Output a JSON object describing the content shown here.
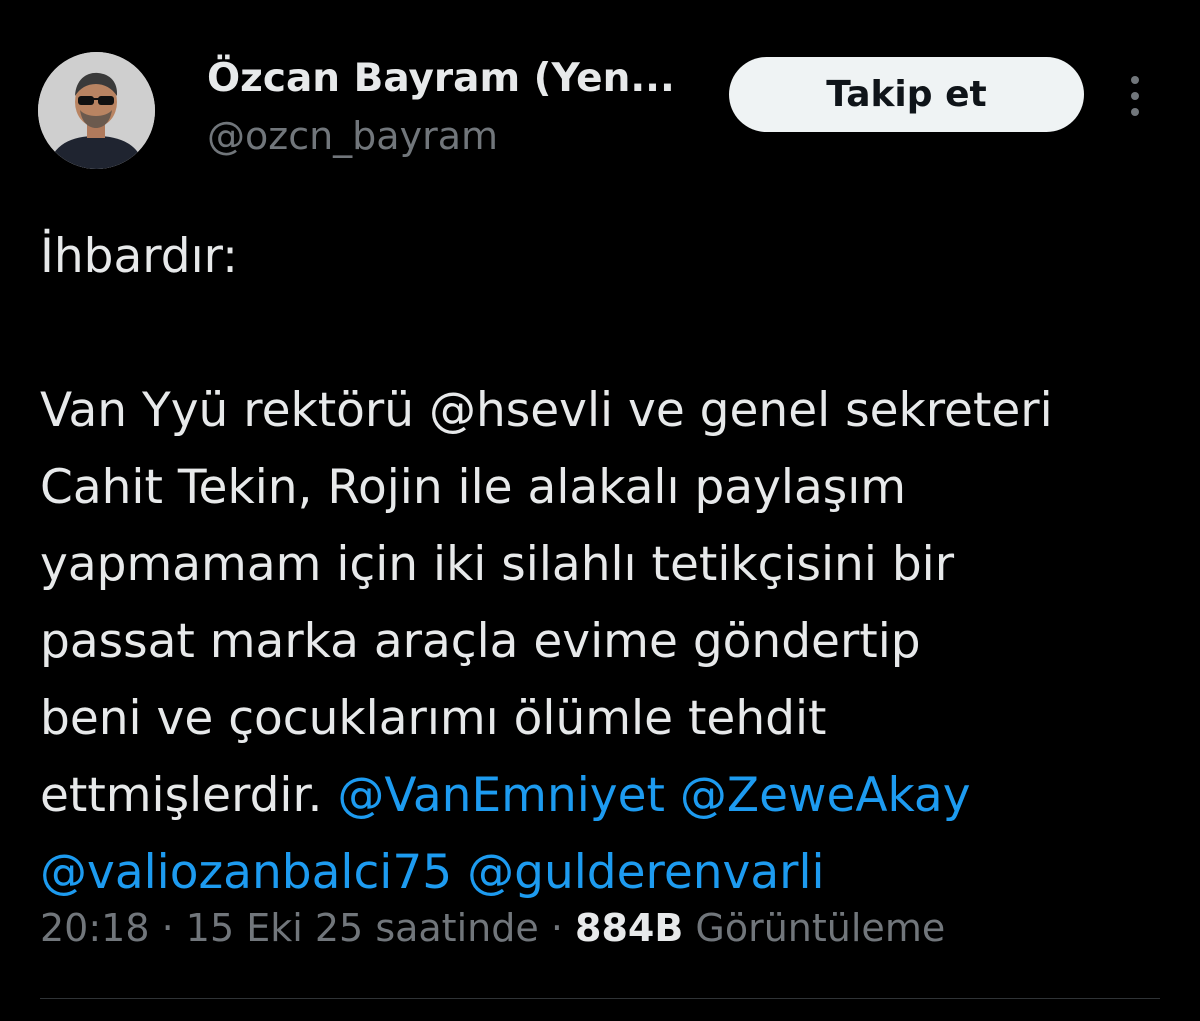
{
  "author": {
    "display_name": "Özcan Bayram (Yen...",
    "handle": "@ozcn_bayram",
    "avatar_icon": "profile-photo"
  },
  "actions": {
    "follow_label": "Takip et",
    "more_icon": "more-vertical-icon"
  },
  "tweet": {
    "heading": "İhbardır:",
    "lines": [
      "Van Yyü rektörü @hsevli ve genel sekreteri",
      "Cahit Tekin, Rojin ile alakalı paylaşım",
      "yapmamam için iki silahlı tetikçisini bir",
      "passat marka araçla evime göndertip",
      "beni ve çocuklarımı ölümle tehdit"
    ],
    "last_line_text": "ettmişlerdir.",
    "mentions": [
      "@VanEmniyet",
      "@ZeweAkay",
      "@valiozanbalci75",
      "@gulderenvarli"
    ]
  },
  "meta": {
    "time": "20:18",
    "separator": "·",
    "date": "15 Eki 25 saatinde",
    "views_count": "884B",
    "views_label": "Görüntüleme"
  },
  "colors": {
    "background": "#000000",
    "text": "#e7e9ea",
    "secondary": "#71767b",
    "link": "#1d9bf0",
    "button_bg": "#eff3f4"
  }
}
